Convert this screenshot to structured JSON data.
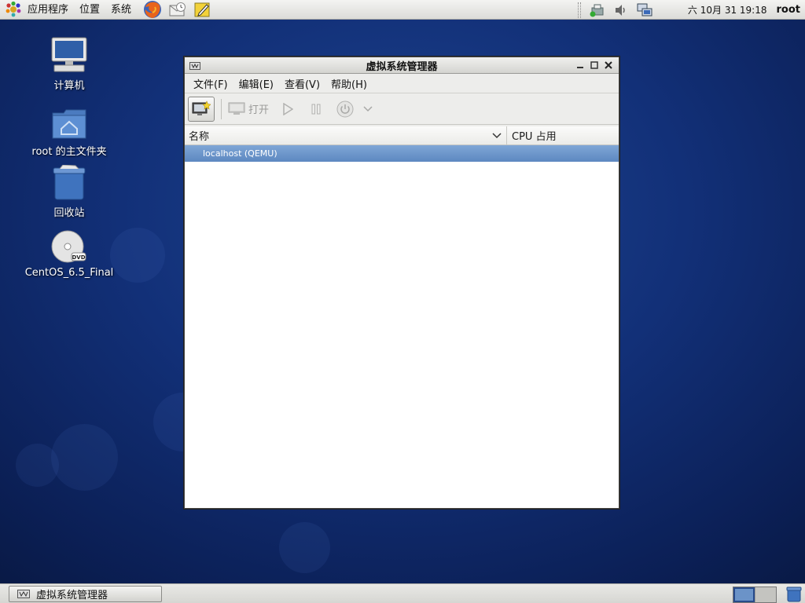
{
  "top_panel": {
    "menus": [
      "应用程序",
      "位置",
      "系统"
    ],
    "launchers": [
      "firefox-icon",
      "mail-icon",
      "notes-icon"
    ],
    "clock": "六 10月 31 19:18",
    "user": "root"
  },
  "desktop": {
    "icons": [
      {
        "label": "计算机",
        "icon": "computer-icon"
      },
      {
        "label": "root 的主文件夹",
        "icon": "home-folder-icon"
      },
      {
        "label": "回收站",
        "icon": "trash-icon"
      },
      {
        "label": "CentOS_6.5_Final",
        "icon": "dvd-icon"
      }
    ]
  },
  "window": {
    "title": "虚拟系统管理器",
    "menus": [
      "文件(F)",
      "编辑(E)",
      "查看(V)",
      "帮助(H)"
    ],
    "toolbar": {
      "open_label": "打开"
    },
    "list": {
      "columns": [
        "名称",
        "CPU 占用"
      ],
      "rows": [
        "localhost (QEMU)"
      ]
    }
  },
  "taskbar": {
    "task_label": "虚拟系统管理器"
  },
  "colors": {
    "selection": "#5d88c1",
    "desktop_bg": "#123078"
  }
}
